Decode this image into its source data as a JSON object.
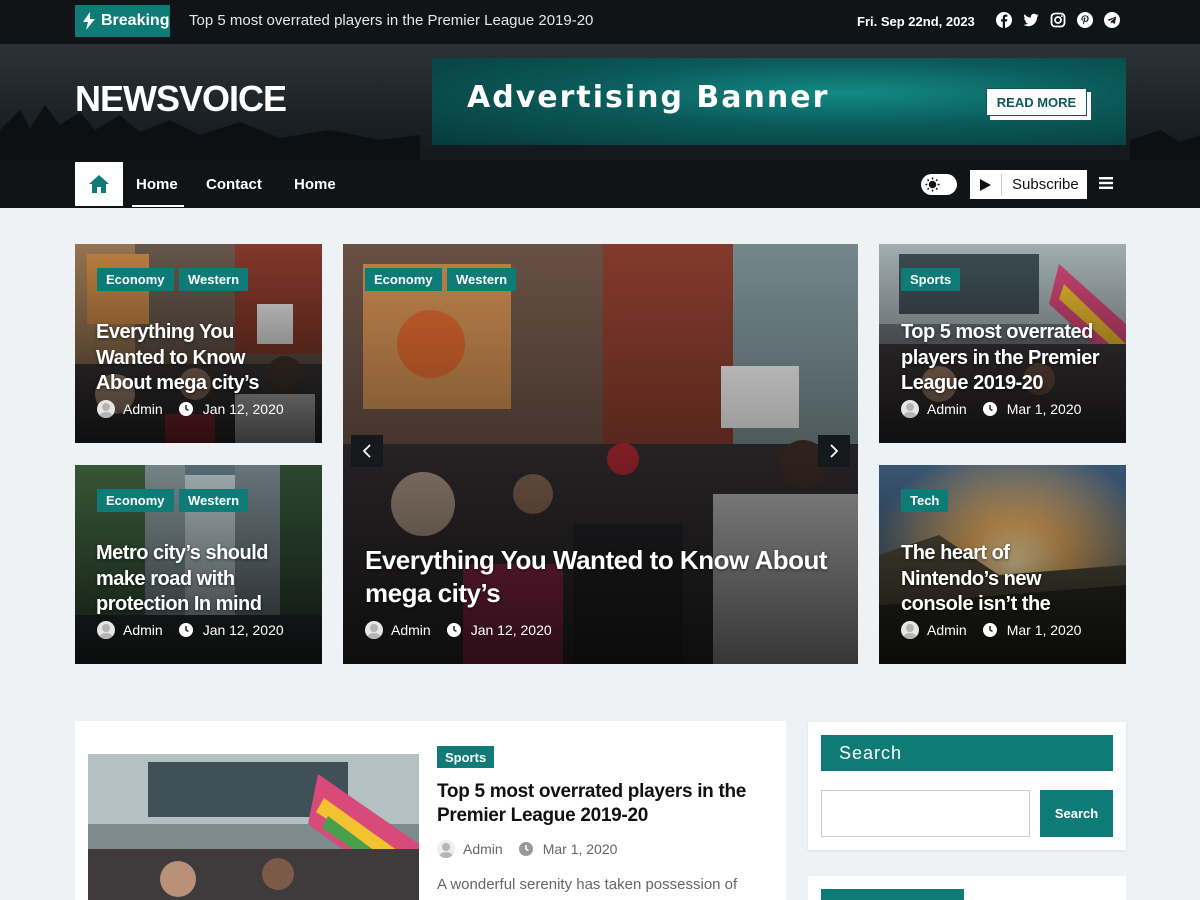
{
  "topbar": {
    "breaking_label": "Breaking",
    "breaking_headline": "Top 5 most overrated players in the Premier League 2019-20",
    "date": "Fri. Sep 22nd, 2023",
    "social_icons": [
      "facebook-icon",
      "twitter-icon",
      "instagram-icon",
      "pinterest-icon",
      "telegram-icon"
    ]
  },
  "header": {
    "logo": "NEWSVOICE",
    "ad_title": "Advertising Banner",
    "ad_button": "READ MORE"
  },
  "nav": {
    "items": [
      "Home",
      "Contact",
      "Home"
    ],
    "subscribe": "Subscribe"
  },
  "cards": {
    "top_left": {
      "categories": [
        "Economy",
        "Western"
      ],
      "title": "Everything You Wanted to Know About mega city’s",
      "author": "Admin",
      "date": "Jan 12, 2020"
    },
    "bottom_left": {
      "categories": [
        "Economy",
        "Western"
      ],
      "title": "Metro city’s should make road with protection In mind",
      "author": "Admin",
      "date": "Jan 12, 2020"
    },
    "featured": {
      "categories": [
        "Economy",
        "Western"
      ],
      "title": "Everything You Wanted to Know About mega city’s",
      "author": "Admin",
      "date": "Jan 12, 2020"
    },
    "top_right": {
      "categories": [
        "Sports"
      ],
      "title": "Top 5 most overrated players in the Premier League 2019-20",
      "author": "Admin",
      "date": "Mar 1, 2020"
    },
    "bottom_right": {
      "categories": [
        "Tech"
      ],
      "title": "The heart of Nintendo’s new console isn’t the",
      "author": "Admin",
      "date": "Mar 1, 2020"
    }
  },
  "post": {
    "category": "Sports",
    "title": "Top 5 most overrated players in the Premier League 2019-20",
    "author": "Admin",
    "date": "Mar 1, 2020",
    "excerpt": "A wonderful serenity has taken possession of"
  },
  "sidebar": {
    "search_title": "Search",
    "search_placeholder": "",
    "search_button": "Search"
  },
  "colors": {
    "accent": "#0e7b77",
    "dark": "#111417",
    "background": "#eef2f5"
  }
}
